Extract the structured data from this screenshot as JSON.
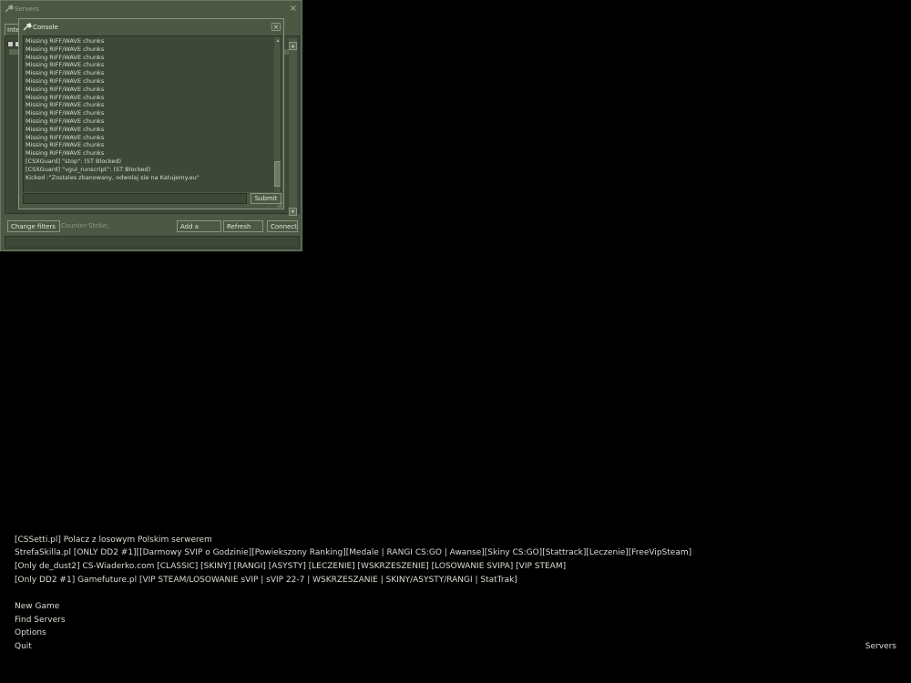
{
  "servers_window": {
    "title": "Servers",
    "close_glyph": "×",
    "tab_label": "Inter",
    "buttons": {
      "change_filters": "Change filters",
      "add_server": "Add a Server",
      "refresh": "Refresh",
      "connect": "Connect"
    },
    "filter_text": "Counter-Strike;"
  },
  "console": {
    "title": "Console",
    "close_glyph": "×",
    "lines": [
      "Missing RIFF/WAVE chunks",
      "Missing RIFF/WAVE chunks",
      "Missing RIFF/WAVE chunks",
      "Missing RIFF/WAVE chunks",
      "Missing RIFF/WAVE chunks",
      "Missing RIFF/WAVE chunks",
      "Missing RIFF/WAVE chunks",
      "Missing RIFF/WAVE chunks",
      "Missing RIFF/WAVE chunks",
      "Missing RIFF/WAVE chunks",
      "Missing RIFF/WAVE chunks",
      "Missing RIFF/WAVE chunks",
      "Missing RIFF/WAVE chunks",
      "Missing RIFF/WAVE chunks",
      "Missing RIFF/WAVE chunks",
      "[CSXGuard] \"stop\": (ST Blocked)",
      "[CSXGuard] \"vgui_runscript\": (ST Blocked)",
      "Kicked :\"Zostales zbanowany, odwolaj sie na Katujemy.eu\""
    ],
    "input_value": "",
    "submit_label": "Submit"
  },
  "main_menu": {
    "servers_list": [
      "[CSSetti.pl] Polacz z losowym Polskim serwerem",
      "StrefaSkilla.pl [ONLY DD2 #1][[Darmowy SVIP o Godzinie][Powiekszony Ranking][Medale | RANGI CS:GO | Awanse][Skiny CS:GO][Stattrack][Leczenie][FreeVipSteam]",
      "[Only de_dust2] CS-Wiaderko.com [CLASSIC] [SKINY] [RANGI] [ASYSTY] [LECZENIE] [WSKRZESZENIE] [LOSOWANIE SVIPA] [VIP STEAM]",
      "[Only DD2 #1] Gamefuture.pl [VIP STEAM/LOSOWANIE sVIP | sVIP 22-7 | WSKRZESZANIE | SKINY/ASYSTY/RANGI | StatTrak]"
    ],
    "items": [
      "New Game",
      "Find Servers",
      "Options",
      "Quit"
    ],
    "bottom_right": "Servers"
  },
  "colors": {
    "panel": "#4c5844",
    "panel_dark": "#3e4838",
    "border": "#8a9480",
    "text": "#d8dcd0",
    "background": "#000000"
  },
  "icons": {
    "window_icon": "steam-wrench-icon",
    "scroll_up": "arrow-up-icon",
    "scroll_down": "arrow-down-icon"
  }
}
